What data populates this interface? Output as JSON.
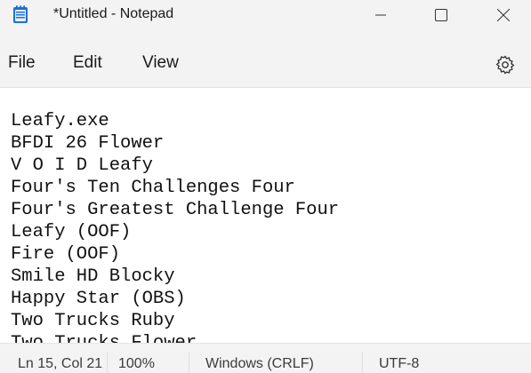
{
  "window": {
    "title": "*Untitled - Notepad",
    "app_icon": "notepad-icon",
    "controls": {
      "minimize_icon": "minimize-icon",
      "maximize_icon": "maximize-icon",
      "close_icon": "close-icon"
    }
  },
  "menu": {
    "items": [
      "File",
      "Edit",
      "View"
    ],
    "settings_icon": "gear-icon"
  },
  "editor": {
    "lines": [
      "Leafy.exe",
      "BFDI 26 Flower",
      "V O I D Leafy",
      "Four's Ten Challenges Four",
      "Four's Greatest Challenge Four",
      "Leafy (OOF)",
      "Fire (OOF)",
      "Smile HD Blocky",
      "Happy Star (OBS)",
      "Two Trucks Ruby",
      "Two Trucks Flower"
    ]
  },
  "status": {
    "position": "Ln 15, Col 21",
    "zoom": "100%",
    "line_ending": "Windows (CRLF)",
    "encoding": "UTF-8"
  },
  "colors": {
    "chrome_bg": "#f3f3f3",
    "editor_bg": "#ffffff",
    "icon_accent": "#1e6fd9"
  }
}
